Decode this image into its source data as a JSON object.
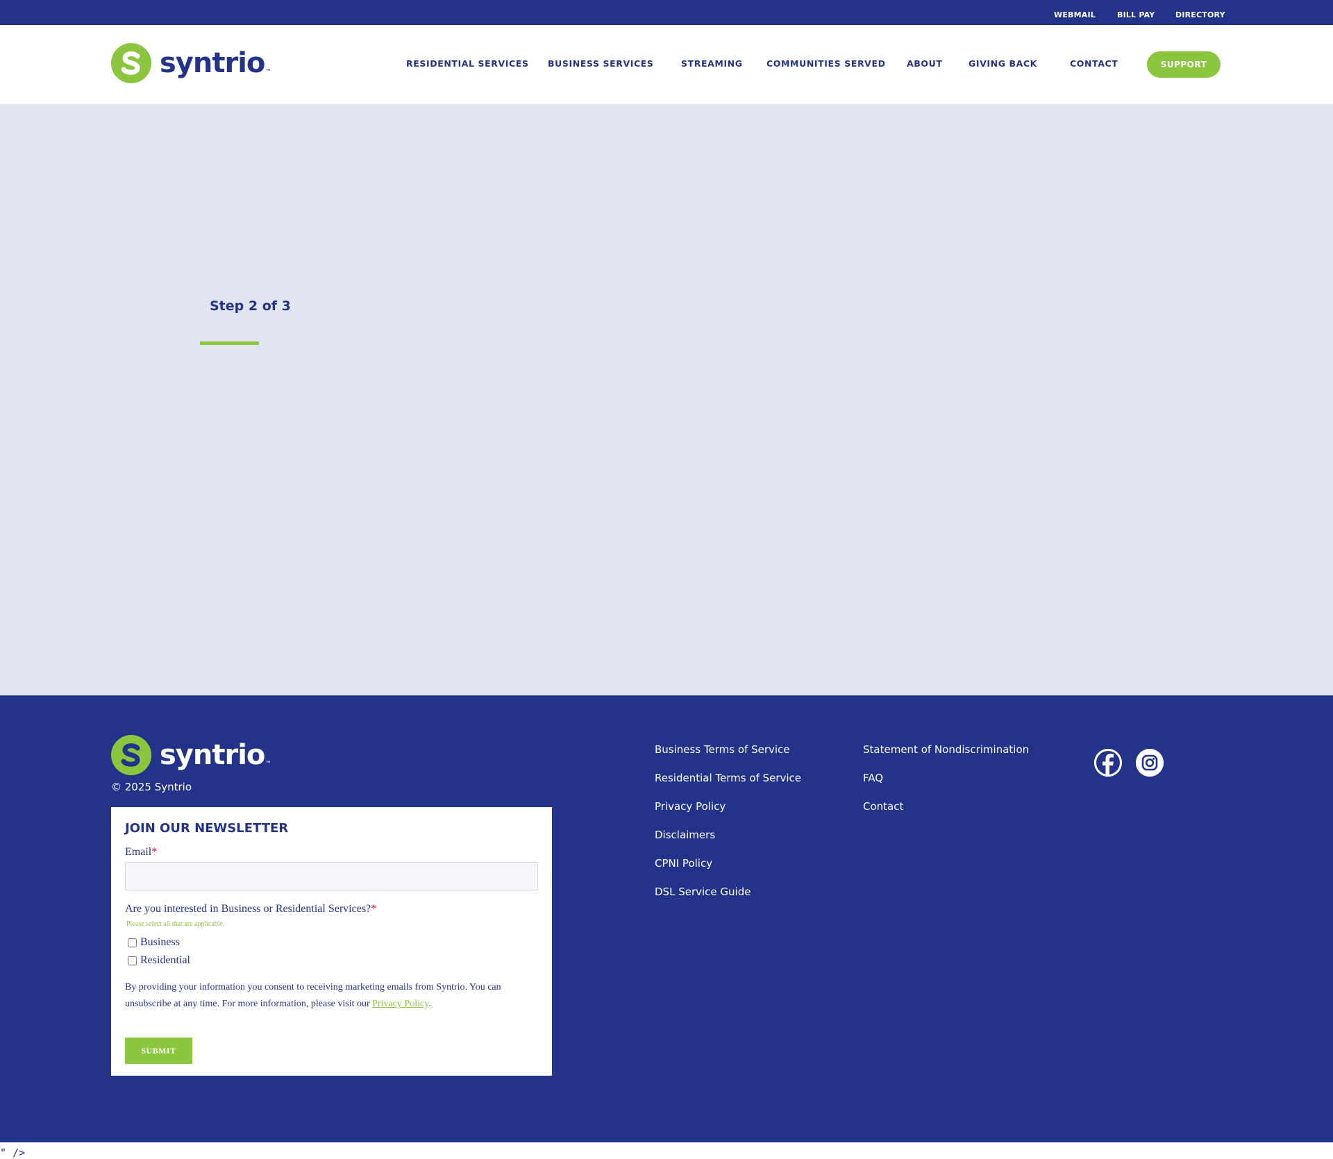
{
  "colors": {
    "brand_navy": "#23338a",
    "brand_green": "#8cc63f",
    "page_bg": "#e2e6f2",
    "required": "#e4002b"
  },
  "utility_nav": {
    "webmail": "WEBMAIL",
    "bill_pay": "BILL PAY",
    "directory": "DIRECTORY"
  },
  "brand": {
    "name": "syntrio",
    "tm": "™",
    "icon": "syntrio-logo-icon"
  },
  "main_nav": {
    "items": [
      "RESIDENTIAL SERVICES",
      "BUSINESS SERVICES",
      "STREAMING",
      "COMMUNITIES SERVED",
      "ABOUT",
      "GIVING BACK",
      "CONTACT"
    ],
    "support": "SUPPORT"
  },
  "main": {
    "step_label": "Step 2 of 3",
    "step_current": 2,
    "step_total": 3
  },
  "footer": {
    "copyright": "© 2025 Syntrio",
    "links_col1": [
      "Business Terms of Service",
      "Residential Terms of Service",
      "Privacy Policy",
      "Disclaimers",
      "CPNI Policy",
      "DSL Service Guide"
    ],
    "links_col2": [
      "Statement of Nondiscrimination",
      "FAQ",
      "Contact"
    ],
    "social": [
      "facebook-icon",
      "instagram-icon"
    ]
  },
  "newsletter": {
    "title": "JOIN OUR NEWSLETTER",
    "email_label": "Email",
    "required_mark": "*",
    "email_value": "",
    "question": "Are you interested in Business or Residential Services?",
    "hint": "Please select all that are applicable.",
    "options": [
      "Business",
      "Residential"
    ],
    "consent_text": "By providing your information you consent to receiving marketing emails from Syntrio. You can unsubscribe at any time. For more information, please visit our ",
    "privacy_link": "Privacy Policy",
    "consent_end": ".",
    "submit": "SUBMIT"
  },
  "stray_text": "\" />"
}
